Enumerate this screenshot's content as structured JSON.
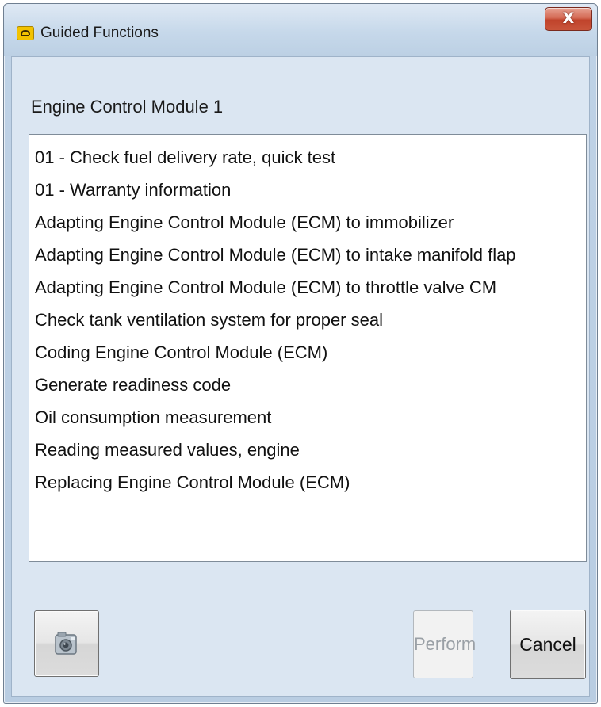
{
  "window": {
    "title": "Guided Functions",
    "close_label": "X"
  },
  "module_title": "Engine Control Module 1",
  "functions": [
    "01 - Check fuel delivery rate, quick test",
    "01 - Warranty information",
    "Adapting Engine Control Module (ECM) to immobilizer",
    "Adapting Engine Control Module (ECM) to intake manifold flap",
    "Adapting Engine Control Module (ECM) to throttle valve CM",
    "Check tank ventilation system for proper seal",
    "Coding Engine Control Module (ECM)",
    "Generate readiness code",
    "Oil consumption measurement",
    "Reading measured values, engine",
    "Replacing Engine Control Module (ECM)"
  ],
  "buttons": {
    "camera_icon": "camera-icon",
    "perform_label": "Perform",
    "perform_enabled": false,
    "cancel_label": "Cancel"
  },
  "colors": {
    "window_frame": "#bfd2e6",
    "close_button": "#c9553b",
    "app_icon": "#f2c200",
    "disabled_text": "#9aa0a6"
  }
}
